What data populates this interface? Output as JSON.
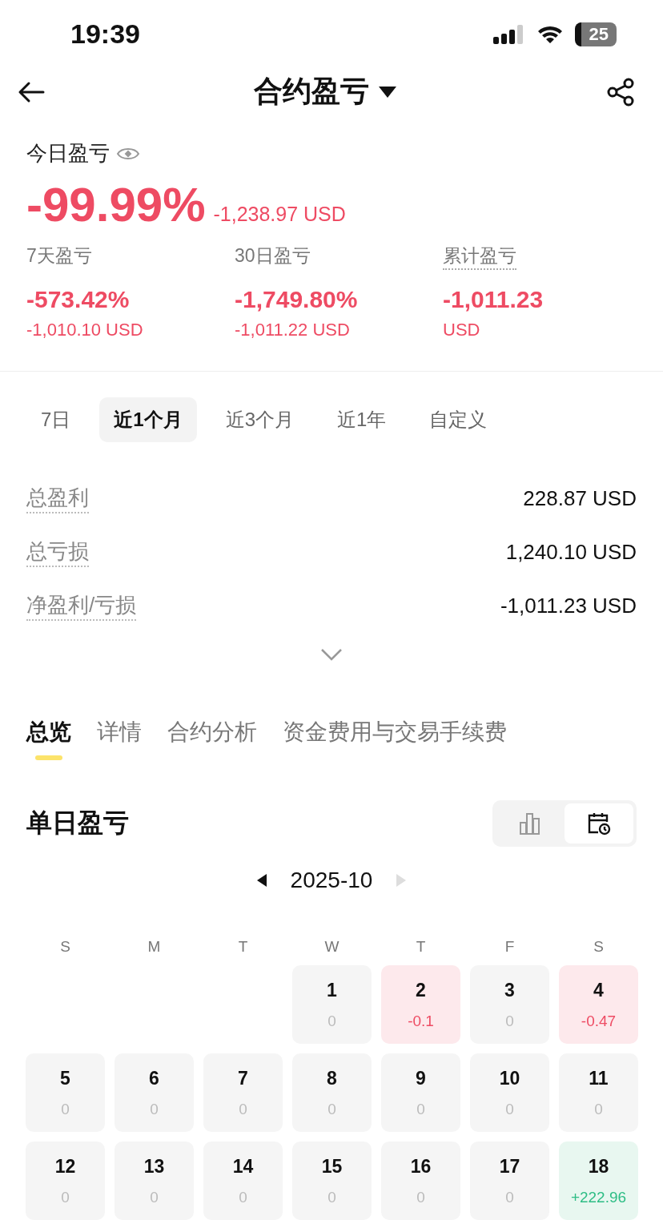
{
  "status_bar": {
    "time": "19:39",
    "battery": "25"
  },
  "header": {
    "title": "合约盈亏"
  },
  "today": {
    "label": "今日盈亏",
    "percent": "-99.99%",
    "amount": "-1,238.97 USD"
  },
  "stats": [
    {
      "label": "7天盈亏",
      "underlined": false,
      "value": "-573.42%",
      "sub": "-1,010.10 USD"
    },
    {
      "label": "30日盈亏",
      "underlined": false,
      "value": "-1,749.80%",
      "sub": "-1,011.22 USD"
    },
    {
      "label": "累计盈亏",
      "underlined": true,
      "value": "-1,011.23",
      "sub": "USD"
    }
  ],
  "periods": [
    {
      "label": "7日",
      "selected": false
    },
    {
      "label": "近1个月",
      "selected": true
    },
    {
      "label": "近3个月",
      "selected": false
    },
    {
      "label": "近1年",
      "selected": false
    },
    {
      "label": "自定义",
      "selected": false
    }
  ],
  "summary": [
    {
      "label": "总盈利",
      "value": "228.87 USD"
    },
    {
      "label": "总亏损",
      "value": "1,240.10 USD"
    },
    {
      "label": "净盈利/亏损",
      "value": "-1,011.23 USD"
    }
  ],
  "sections": [
    {
      "label": "总览",
      "selected": true
    },
    {
      "label": "详情",
      "selected": false
    },
    {
      "label": "合约分析",
      "selected": false
    },
    {
      "label": "资金费用与交易手续费",
      "selected": false
    }
  ],
  "daily": {
    "title": "单日盈亏",
    "views": [
      {
        "kind": "bars",
        "selected": false
      },
      {
        "kind": "calendar",
        "selected": true
      }
    ],
    "month": "2025-10",
    "next_disabled": true,
    "weekdays": [
      "S",
      "M",
      "T",
      "W",
      "T",
      "F",
      "S"
    ],
    "weeks": [
      [
        {
          "kind": "blank"
        },
        {
          "kind": "blank"
        },
        {
          "kind": "blank"
        },
        {
          "day": "1",
          "value": "0",
          "kind": "flat"
        },
        {
          "day": "2",
          "value": "-0.1",
          "kind": "loss"
        },
        {
          "day": "3",
          "value": "0",
          "kind": "flat"
        },
        {
          "day": "4",
          "value": "-0.47",
          "kind": "loss"
        }
      ],
      [
        {
          "day": "5",
          "value": "0",
          "kind": "flat"
        },
        {
          "day": "6",
          "value": "0",
          "kind": "flat"
        },
        {
          "day": "7",
          "value": "0",
          "kind": "flat"
        },
        {
          "day": "8",
          "value": "0",
          "kind": "flat"
        },
        {
          "day": "9",
          "value": "0",
          "kind": "flat"
        },
        {
          "day": "10",
          "value": "0",
          "kind": "flat"
        },
        {
          "day": "11",
          "value": "0",
          "kind": "flat"
        }
      ],
      [
        {
          "day": "12",
          "value": "0",
          "kind": "flat"
        },
        {
          "day": "13",
          "value": "0",
          "kind": "flat"
        },
        {
          "day": "14",
          "value": "0",
          "kind": "flat"
        },
        {
          "day": "15",
          "value": "0",
          "kind": "flat"
        },
        {
          "day": "16",
          "value": "0",
          "kind": "flat"
        },
        {
          "day": "17",
          "value": "0",
          "kind": "flat"
        },
        {
          "day": "18",
          "value": "+222.96",
          "kind": "gain"
        }
      ]
    ]
  }
}
